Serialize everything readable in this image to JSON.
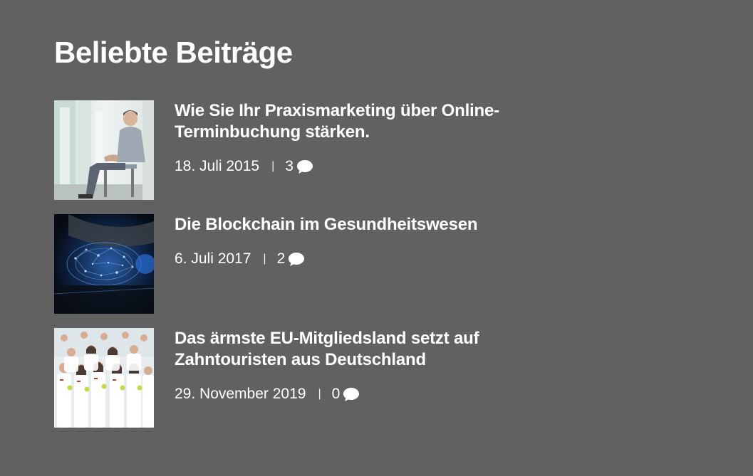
{
  "widget": {
    "title": "Beliebte Beiträge"
  },
  "posts": [
    {
      "title": "Wie Sie Ihr Praxismarketing über Online-Terminbuchung stärken.",
      "date": "18. Juli 2015",
      "separator": "|",
      "comments": "3",
      "thumbnail_icon": "man-waiting-room-photo"
    },
    {
      "title": "Die Blockchain im Gesundheitswesen",
      "date": "6. Juli 2017",
      "separator": "|",
      "comments": "2",
      "thumbnail_icon": "blockchain-network-photo"
    },
    {
      "title": "Das ärmste EU-Mitgliedsland setzt auf Zahntouristen aus Deutschland",
      "date": "29. November 2019",
      "separator": "|",
      "comments": "0",
      "thumbnail_icon": "dental-team-photo"
    }
  ],
  "colors": {
    "background": "#616161",
    "text": "#ffffff"
  }
}
